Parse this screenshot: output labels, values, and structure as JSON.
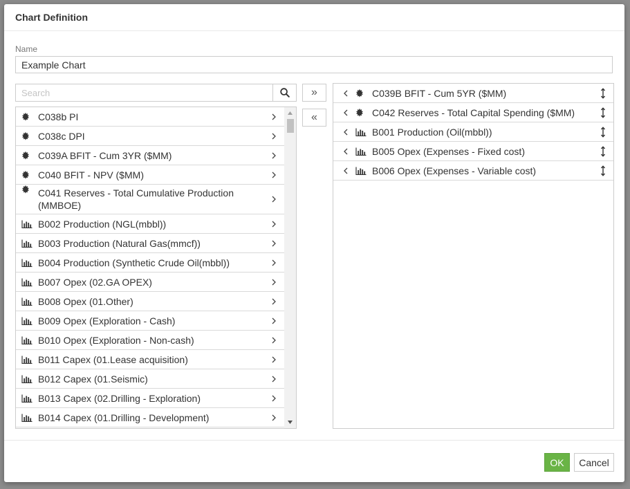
{
  "dialog": {
    "title": "Chart Definition"
  },
  "name_field": {
    "label": "Name",
    "value": "Example Chart"
  },
  "search": {
    "placeholder": "Search"
  },
  "move_buttons": {
    "add_all": "»",
    "remove_all": "«"
  },
  "available_items": [
    {
      "label": "C038b PI",
      "icon": "burst-icon"
    },
    {
      "label": "C038c DPI",
      "icon": "burst-icon"
    },
    {
      "label": "C039A BFIT - Cum 3YR ($MM)",
      "icon": "burst-icon"
    },
    {
      "label": "C040 BFIT - NPV ($MM)",
      "icon": "burst-icon"
    },
    {
      "label": "C041 Reserves - Total Cumulative Production (MMBOE)",
      "icon": "burst-icon"
    },
    {
      "label": "B002 Production (NGL(mbbl))",
      "icon": "bar-chart-icon"
    },
    {
      "label": "B003 Production (Natural Gas(mmcf))",
      "icon": "bar-chart-icon"
    },
    {
      "label": "B004 Production (Synthetic Crude Oil(mbbl))",
      "icon": "bar-chart-icon"
    },
    {
      "label": "B007 Opex (02.GA OPEX)",
      "icon": "bar-chart-icon"
    },
    {
      "label": "B008 Opex (01.Other)",
      "icon": "bar-chart-icon"
    },
    {
      "label": "B009 Opex (Exploration - Cash)",
      "icon": "bar-chart-icon"
    },
    {
      "label": "B010 Opex (Exploration - Non-cash)",
      "icon": "bar-chart-icon"
    },
    {
      "label": "B011 Capex (01.Lease acquisition)",
      "icon": "bar-chart-icon"
    },
    {
      "label": "B012 Capex (01.Seismic)",
      "icon": "bar-chart-icon"
    },
    {
      "label": "B013 Capex (02.Drilling - Exploration)",
      "icon": "bar-chart-icon"
    },
    {
      "label": "B014 Capex (01.Drilling - Development)",
      "icon": "bar-chart-icon"
    }
  ],
  "selected_items": [
    {
      "label": "C039B BFIT - Cum 5YR ($MM)",
      "icon": "burst-icon"
    },
    {
      "label": "C042 Reserves - Total Capital Spending ($MM)",
      "icon": "burst-icon"
    },
    {
      "label": "B001 Production (Oil(mbbl))",
      "icon": "bar-chart-icon"
    },
    {
      "label": "B005 Opex (Expenses - Fixed cost)",
      "icon": "bar-chart-icon"
    },
    {
      "label": "B006 Opex (Expenses - Variable cost)",
      "icon": "bar-chart-icon"
    }
  ],
  "footer": {
    "ok_label": "OK",
    "cancel_label": "Cancel"
  },
  "colors": {
    "accent": "#6ab446",
    "border": "#cccccc",
    "text": "#333333"
  }
}
